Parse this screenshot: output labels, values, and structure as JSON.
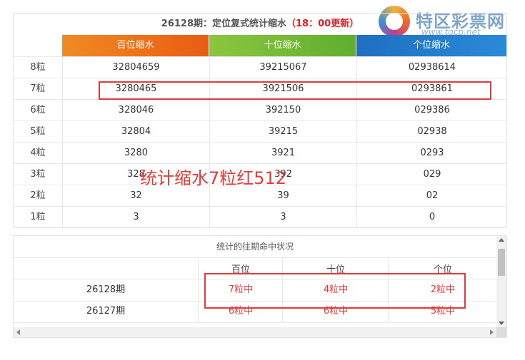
{
  "header": {
    "title": "26128期：定位复式统计缩水",
    "update": "（18：00更新）"
  },
  "logo": {
    "name": "特区彩票网",
    "url": "www.tqcp.net"
  },
  "columns": [
    "百位缩水",
    "十位缩水",
    "个位缩水"
  ],
  "rows": [
    {
      "label": "8粒",
      "values": [
        "32804659",
        "39215067",
        "02938614"
      ]
    },
    {
      "label": "7粒",
      "values": [
        "3280465",
        "3921506",
        "0293861"
      ]
    },
    {
      "label": "6粒",
      "values": [
        "328046",
        "392150",
        "029386"
      ]
    },
    {
      "label": "5粒",
      "values": [
        "32804",
        "39215",
        "02938"
      ]
    },
    {
      "label": "4粒",
      "values": [
        "3280",
        "3921",
        "0293"
      ]
    },
    {
      "label": "3粒",
      "values": [
        "328",
        "392",
        "029"
      ]
    },
    {
      "label": "2粒",
      "values": [
        "32",
        "39",
        "02"
      ]
    },
    {
      "label": "1粒",
      "values": [
        "3",
        "3",
        "0"
      ]
    }
  ],
  "overlay_text": "统计缩水7粒红512",
  "history": {
    "title": "统计的往期命中状况",
    "headers": [
      "百位",
      "十位",
      "个位"
    ],
    "rows": [
      {
        "period": "26128期",
        "values": [
          "7粒中",
          "4粒中",
          "2粒中"
        ]
      },
      {
        "period": "26127期",
        "values": [
          "6粒中",
          "6粒中",
          "5粒中"
        ]
      }
    ]
  },
  "colors": {
    "accent_red": "#e53a3a",
    "hundreds_header": "#e95c12",
    "tens_header": "#5fae2e",
    "units_header": "#1f6fc1"
  }
}
